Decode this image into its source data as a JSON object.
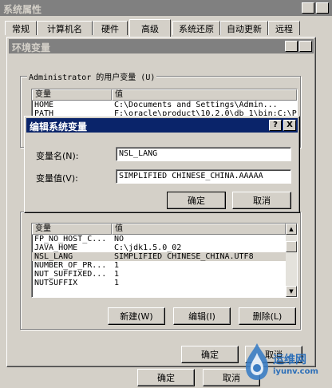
{
  "sysprops": {
    "title": "系统属性",
    "help_btn": "?",
    "close_btn": "X",
    "tabs": [
      "常规",
      "计算机名",
      "硬件",
      "高级",
      "系统还原",
      "自动更新",
      "远程"
    ],
    "ok_label": "确定",
    "cancel_label": "取消"
  },
  "envvars": {
    "title": "环境变量",
    "help_btn": "?",
    "close_btn": "X",
    "user_group_label": "Administrator 的用户变量 (U)",
    "user_table": {
      "headers": [
        "变量",
        "值"
      ],
      "rows": [
        {
          "name": "HOME",
          "value": "C:\\Documents and Settings\\Admin..."
        },
        {
          "name": "PATH",
          "value": "F:\\oracle\\product\\10.2.0\\db_1\\bin;C:\\P..."
        }
      ]
    },
    "sys_table": {
      "headers": [
        "变量",
        "值"
      ],
      "rows": [
        {
          "name": "FP_NO_HOST_C...",
          "value": "NO"
        },
        {
          "name": "JAVA_HOME",
          "value": "C:\\jdk1.5.0_02"
        },
        {
          "name": "NSL_LANG",
          "value": "SIMPLIFIED CHINESE_CHINA.UTF8"
        },
        {
          "name": "NUMBER_OF_PR...",
          "value": "1"
        },
        {
          "name": "NUT_SUFFIXED...",
          "value": "1"
        },
        {
          "name": "NUTSUFFIX",
          "value": "1"
        }
      ]
    },
    "new_label": "新建(W)",
    "edit_label": "编辑(I)",
    "delete_label": "删除(L)",
    "ok_label": "确定",
    "cancel_label": "取消"
  },
  "edit_dialog": {
    "title": "编辑系统变量",
    "help_btn": "?",
    "close_btn": "X",
    "name_label": "变量名(N):",
    "name_value": "NSL_LANG",
    "value_label": "变量值(V):",
    "value_value": "SIMPLIFIED CHINESE_CHINA.AAAAA",
    "ok_label": "确定",
    "cancel_label": "取消"
  },
  "watermark": {
    "text_cn": "运维网",
    "text_en": "iyunv.com"
  },
  "colors": {
    "dialog_bg": "#d4d0c8",
    "title_active": "#0a246a",
    "title_inactive": "#808080"
  }
}
